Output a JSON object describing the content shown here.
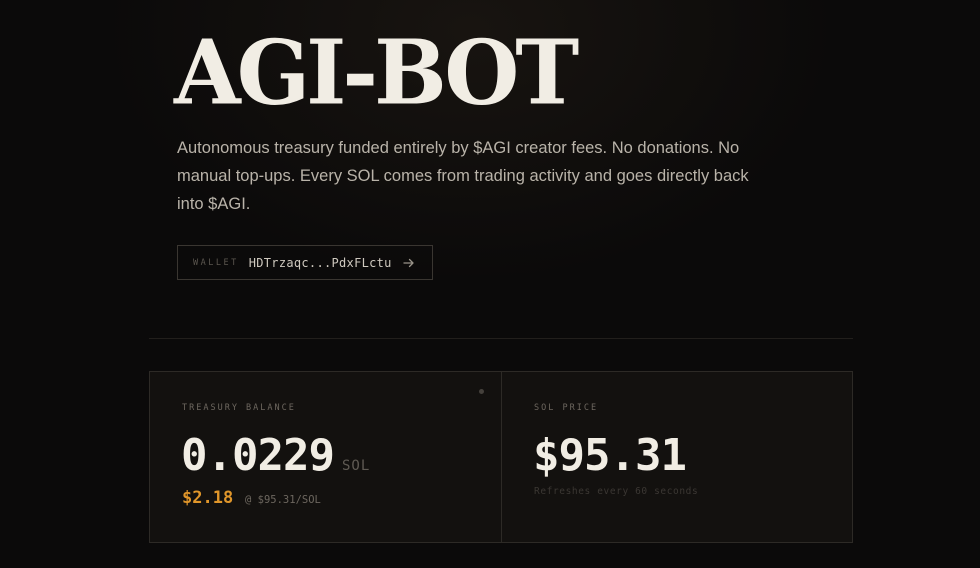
{
  "hero": {
    "title": "AGI-BOT",
    "description": "Autonomous treasury funded entirely by $AGI creator fees. No donations. No manual top-ups. Every SOL comes from trading activity and goes directly back into $AGI.",
    "wallet": {
      "label": "WALLET",
      "address": "HDTrzaqc...PdxFLctu",
      "icon": "arrow-right-icon"
    }
  },
  "stats": {
    "treasury": {
      "label": "TREASURY BALANCE",
      "value": "0.0229",
      "unit": "SOL",
      "usd_value": "$2.18",
      "rate": "@ $95.31/SOL"
    },
    "sol_price": {
      "label": "SOL PRICE",
      "value": "$95.31",
      "note": "Refreshes every 60 seconds"
    }
  },
  "colors": {
    "background": "#0b0a0a",
    "accent": "#e0962a",
    "text": "#f1ede4"
  }
}
